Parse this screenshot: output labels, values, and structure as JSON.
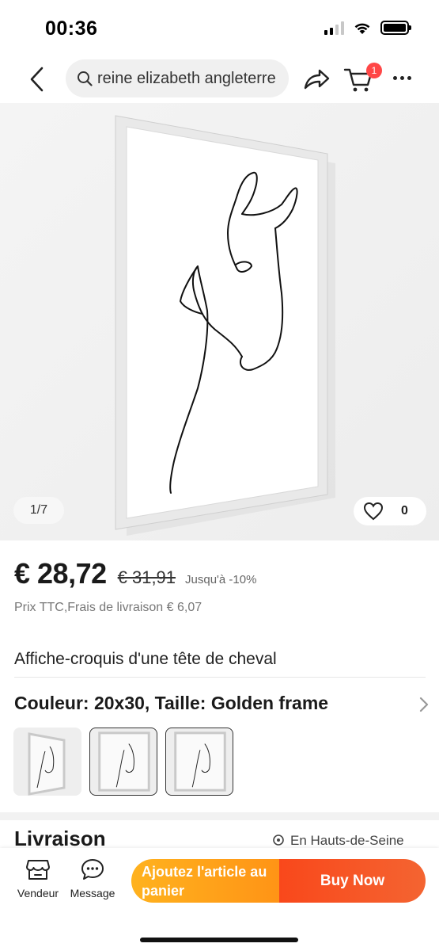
{
  "status_bar": {
    "time": "00:36"
  },
  "nav": {
    "search_text": "reine elizabeth angleterre",
    "cart_badge": "1"
  },
  "gallery": {
    "counter": "1/7",
    "wishlist_count": "0"
  },
  "price": {
    "current": "€ 28,72",
    "old": "€ 31,91",
    "discount": "Jusqu'à -10%",
    "tax_info": "Prix TTC,Frais de livraison € 6,07"
  },
  "product": {
    "title": "Affiche-croquis d'une tête de cheval",
    "variant": "Couleur: 20x30, Taille: Golden frame"
  },
  "delivery": {
    "title": "Livraison",
    "location": "En Hauts-de-Seine"
  },
  "bottom_bar": {
    "seller_label": "Vendeur",
    "message_label": "Message",
    "add_to_cart_label": "Ajoutez l'article au panier",
    "buy_now_label": "Buy Now"
  },
  "colors": {
    "accent_orange": "#ff9416",
    "accent_red": "#f9481b",
    "badge_red": "#ff4747",
    "gallery_bg": "#f2f2f2"
  },
  "icons": [
    "back-icon",
    "search-icon",
    "share-icon",
    "cart-icon",
    "more-icon",
    "heart-icon",
    "chevron-right-icon",
    "location-icon",
    "store-icon",
    "message-icon"
  ]
}
